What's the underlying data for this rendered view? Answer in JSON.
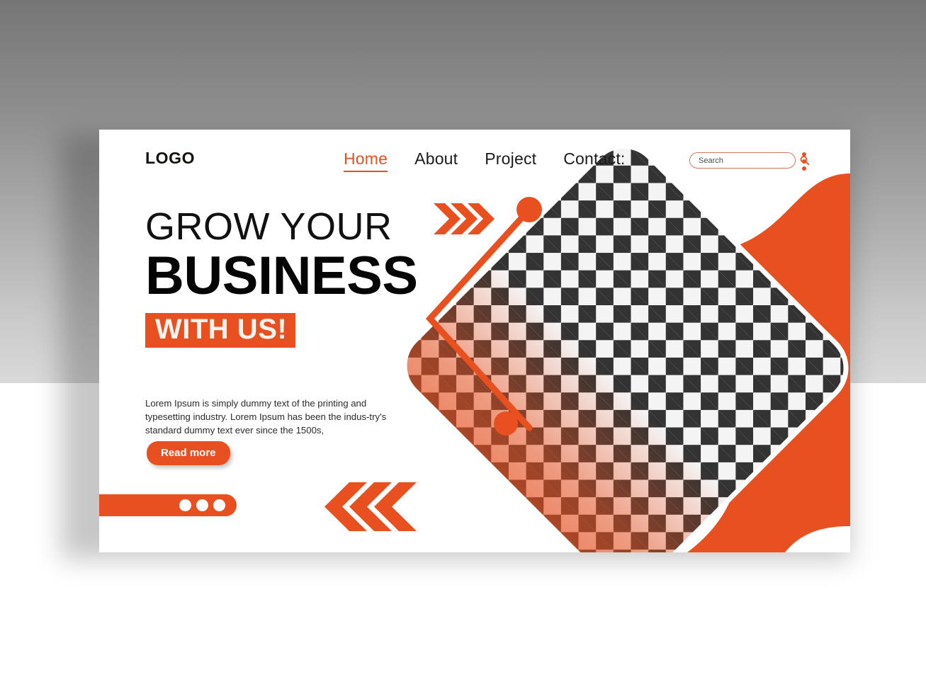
{
  "page": {
    "background_top_color": "#767676",
    "background_bottom_color": "#ffffff",
    "accent_color": "#E9501F",
    "dark_color": "#111111"
  },
  "card": {
    "background": "#ffffff"
  },
  "header": {
    "logo": "LOGO",
    "nav": [
      {
        "label": "Home",
        "active": true
      },
      {
        "label": "About",
        "active": false
      },
      {
        "label": "Project",
        "active": false
      },
      {
        "label": "Contact:",
        "active": false
      }
    ],
    "search": {
      "value": "",
      "placeholder": "Search",
      "icon": "search-icon"
    },
    "menu_icon": "kebab-menu-icon"
  },
  "hero": {
    "line1": "GROW YOUR",
    "line2": "BUSINESS",
    "badge": "WITH US!",
    "body": "Lorem Ipsum is simply dummy text of the printing and typesetting industry. Lorem Ipsum has been the indus-try's standard dummy text ever since the 1500s,",
    "cta_label": "Read more"
  },
  "decor": {
    "chevrons_right_icon": "chevrons-right-icon",
    "chevrons_left_icon": "chevrons-left-icon",
    "image_placeholder_icon": "checkerboard-image-placeholder",
    "wave_icon": "orange-wave-shape",
    "bracket_icon": "angle-bracket-outline"
  },
  "pagination": {
    "dots": [
      {
        "active": true
      },
      {
        "active": true
      },
      {
        "active": true
      }
    ]
  }
}
